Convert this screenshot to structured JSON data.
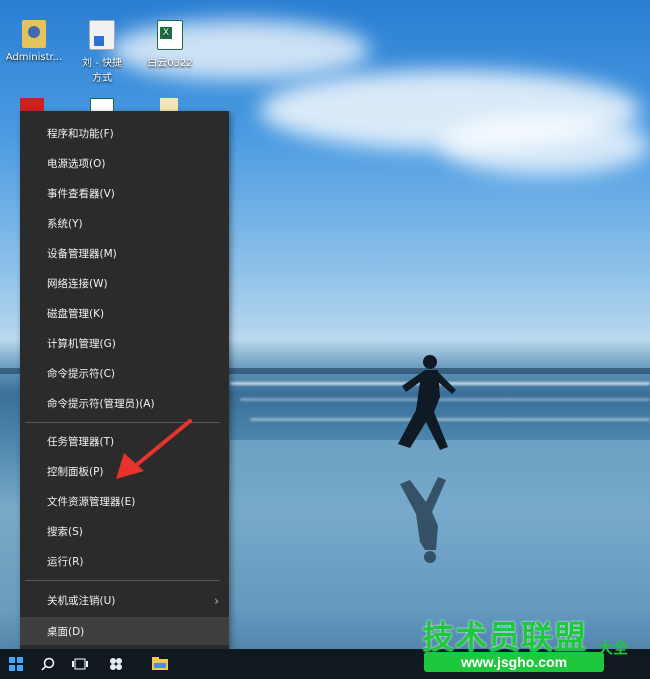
{
  "desktop_icons": [
    {
      "label": "Administr...",
      "icon": "user-folder-icon"
    },
    {
      "label": "刘 - 快捷方式",
      "icon": "shortcut-icon"
    },
    {
      "label": "白云0322",
      "icon": "excel-file-icon"
    }
  ],
  "context_menu": {
    "items": [
      {
        "label": "程序和功能(F)"
      },
      {
        "label": "电源选项(O)"
      },
      {
        "label": "事件查看器(V)"
      },
      {
        "label": "系统(Y)"
      },
      {
        "label": "设备管理器(M)"
      },
      {
        "label": "网络连接(W)"
      },
      {
        "label": "磁盘管理(K)"
      },
      {
        "label": "计算机管理(G)"
      },
      {
        "label": "命令提示符(C)"
      },
      {
        "label": "命令提示符(管理员)(A)"
      },
      {
        "label": "任务管理器(T)"
      },
      {
        "label": "控制面板(P)"
      },
      {
        "label": "文件资源管理器(E)"
      },
      {
        "label": "搜索(S)"
      },
      {
        "label": "运行(R)"
      },
      {
        "label": "关机或注销(U)"
      },
      {
        "label": "桌面(D)"
      }
    ]
  },
  "annotation": {
    "color": "#e8332d"
  },
  "taskbar": {
    "buttons": [
      "windows-start-icon",
      "search-icon",
      "task-view-icon",
      "app-icon",
      "explorer-icon"
    ]
  },
  "watermark": {
    "main": "技术员联盟",
    "suffix": "大全",
    "url": "www.jsgho.com"
  }
}
